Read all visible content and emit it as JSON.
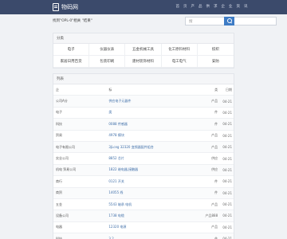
{
  "header": {
    "brand": "物码网",
    "nav": [
      "首",
      "页",
      "产",
      "品",
      "供",
      "求",
      "企",
      "业",
      "资",
      "讯"
    ]
  },
  "search": {
    "hint": "找到\"OPL-0\"相关 \"结果\"",
    "placeholder": "搜"
  },
  "categories": {
    "title": "分类",
    "items": [
      "电子",
      "仪器仪表",
      "五金机械工具",
      "化工原料材料",
      "纺织",
      "家居日用百货",
      "包装印刷",
      "建材装饰材料",
      "电工电气",
      "安防"
    ]
  },
  "listing": {
    "title": "列表",
    "columns": {
      "entity": "企",
      "title": "标",
      "type": "类",
      "date": "日期"
    },
    "rows": [
      {
        "entity": "公司A分",
        "title": "供应电子元器件",
        "type": "产品",
        "date": "04-21"
      },
      {
        "entity": "电子",
        "title": "类",
        "type": "件",
        "date": "04-21"
      },
      {
        "entity": "科技",
        "title": "0088 传感器",
        "type": "件",
        "date": "04-21"
      },
      {
        "entity": "贸易",
        "title": "4978 模块",
        "type": "产品",
        "date": "04-21"
      },
      {
        "entity": "电子有限公司",
        "title": "3jLceg 32320 变频器配件组合",
        "type": "产品",
        "date": "04-21"
      },
      {
        "entity": "实业公司",
        "title": "8852 芯片",
        "type": "供应",
        "date": "04-21"
      },
      {
        "entity": "机电 贸易公司",
        "title": "1822 继电器,接触器",
        "type": "供应",
        "date": "04-21"
      },
      {
        "entity": "商行",
        "title": "0121 开关",
        "type": "件",
        "date": "04-21"
      },
      {
        "entity": "商贸",
        "title": "14055 线",
        "type": "件",
        "date": "04-21"
      },
      {
        "entity": "五金",
        "title": "5543 轴承 电机",
        "type": "产品",
        "date": "04-21"
      },
      {
        "entity": "设备公司",
        "title": "1738 电缆",
        "type": "产品888",
        "date": "04-21"
      },
      {
        "entity": "电器",
        "title": "12320 电源",
        "type": "产品",
        "date": "04-21"
      },
      {
        "entity": "科技",
        "title": "3 2",
        "type": "件",
        "date": "04-21"
      }
    ]
  }
}
